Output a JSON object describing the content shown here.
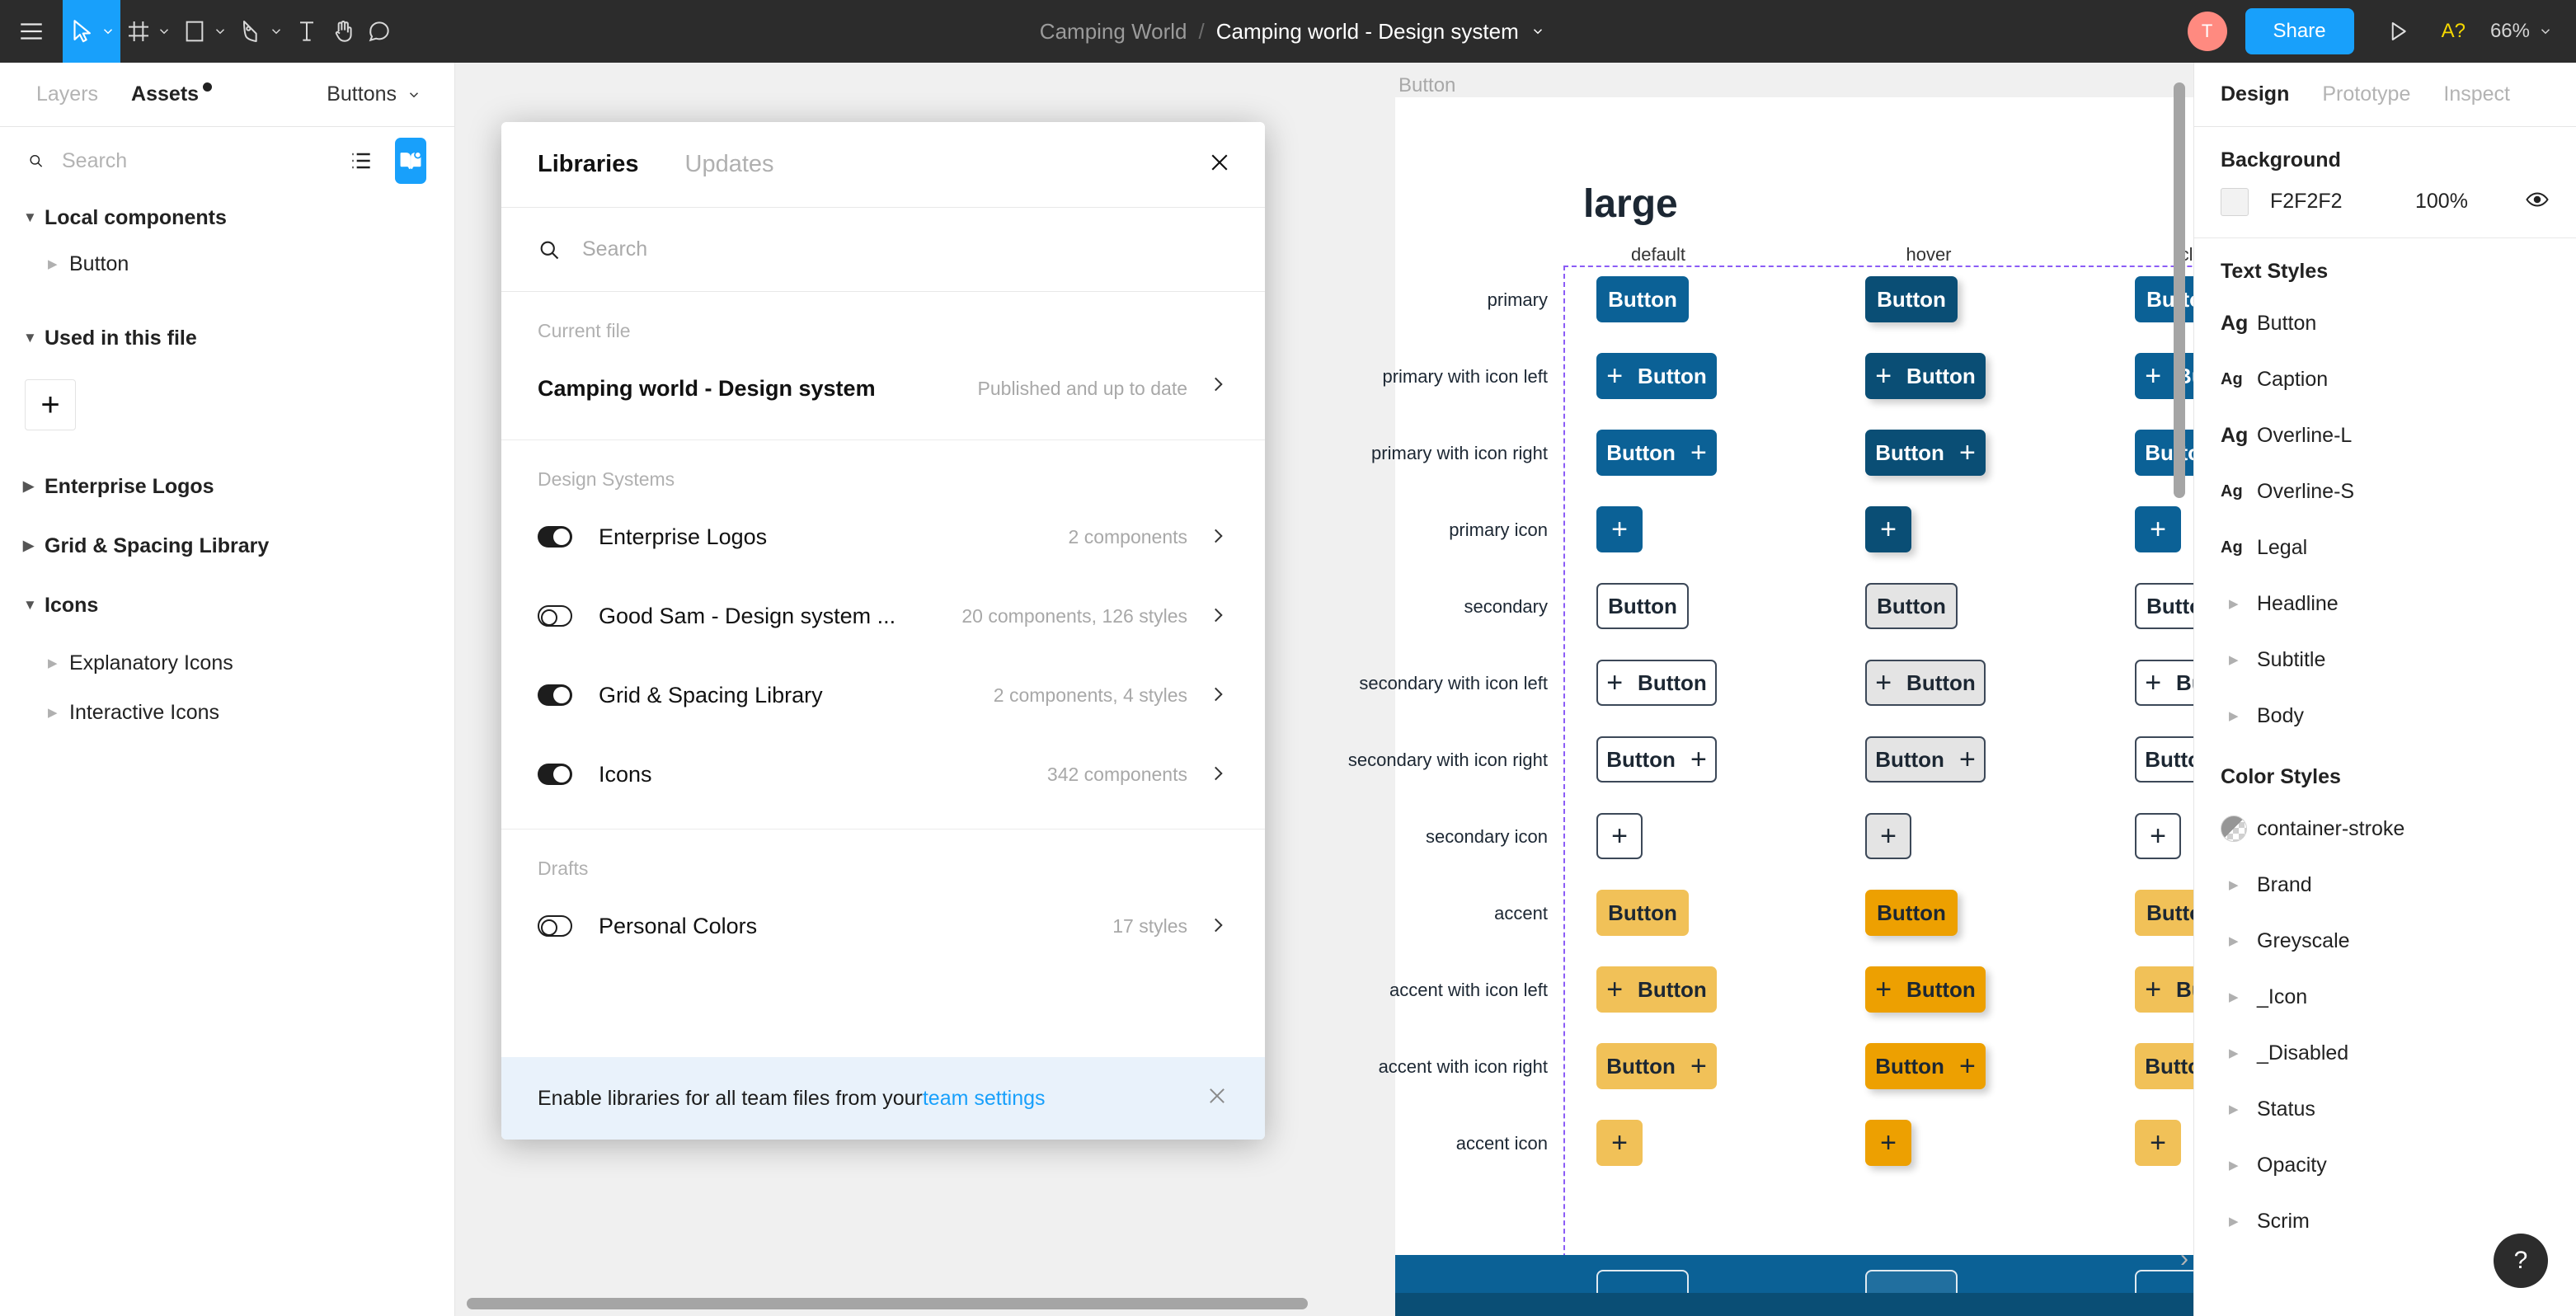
{
  "toolbar": {
    "menu_icon": "hamburger-menu-icon",
    "tools": [
      {
        "name": "move-tool",
        "icon": "cursor-arrow-icon",
        "has_chevron": true,
        "active": true
      },
      {
        "name": "frame-tool",
        "icon": "frame-grid-icon",
        "has_chevron": true,
        "active": false
      },
      {
        "name": "shape-tool",
        "icon": "rectangle-icon",
        "has_chevron": true,
        "active": false
      },
      {
        "name": "pen-tool",
        "icon": "pen-nib-icon",
        "has_chevron": true,
        "active": false
      },
      {
        "name": "text-tool",
        "icon": "text-T-icon",
        "has_chevron": false,
        "active": false
      },
      {
        "name": "hand-tool",
        "icon": "hand-icon",
        "has_chevron": false,
        "active": false
      },
      {
        "name": "comment-tool",
        "icon": "comment-bubble-icon",
        "has_chevron": false,
        "active": false
      }
    ],
    "team_name": "Camping World",
    "separator": "/",
    "file_name": "Camping world - Design system",
    "avatar_initial": "T",
    "share_label": "Share",
    "present_icon": "play-triangle-icon",
    "accessibility_label": "A?",
    "zoom_level": "66%"
  },
  "left_panel": {
    "tabs": [
      {
        "label": "Layers",
        "active": false
      },
      {
        "label": "Assets",
        "active": true,
        "has_dot": true
      }
    ],
    "page_selector": "Buttons",
    "search_placeholder": "Search",
    "search_value": "",
    "view_list_icon": "list-view-icon",
    "view_library_icon": "library-book-icon",
    "sections": [
      {
        "label": "Local components",
        "expanded": true,
        "type": "section"
      },
      {
        "label": "Button",
        "expanded": false,
        "type": "item"
      },
      {
        "label": "Used in this file",
        "expanded": true,
        "type": "section"
      },
      {
        "label": "+",
        "type": "plus"
      },
      {
        "label": "Enterprise Logos",
        "expanded": false,
        "type": "section"
      },
      {
        "label": "Grid & Spacing Library",
        "expanded": false,
        "type": "section"
      },
      {
        "label": "Icons",
        "expanded": true,
        "type": "section"
      },
      {
        "label": "Explanatory Icons",
        "expanded": false,
        "type": "item"
      },
      {
        "label": "Interactive Icons",
        "expanded": false,
        "type": "item"
      }
    ]
  },
  "modal": {
    "tabs": [
      {
        "label": "Libraries",
        "active": true
      },
      {
        "label": "Updates",
        "active": false
      }
    ],
    "close_icon": "close-x-icon",
    "search_placeholder": "Search",
    "search_value": "",
    "groups": [
      {
        "title": "Current file",
        "rows": [
          {
            "name": "Camping world - Design system",
            "meta": "Published and up to date",
            "has_toggle": false,
            "bold": true
          }
        ]
      },
      {
        "title": "Design Systems",
        "rows": [
          {
            "name": "Enterprise Logos",
            "meta": "2 components",
            "has_toggle": true,
            "toggle_on": true
          },
          {
            "name": "Good Sam - Design system ...",
            "meta": "20 components, 126 styles",
            "has_toggle": true,
            "toggle_on": false
          },
          {
            "name": "Grid & Spacing Library",
            "meta": "2 components, 4 styles",
            "has_toggle": true,
            "toggle_on": true
          },
          {
            "name": "Icons",
            "meta": "342 components",
            "has_toggle": true,
            "toggle_on": true
          }
        ]
      },
      {
        "title": "Drafts",
        "rows": [
          {
            "name": "Personal Colors",
            "meta": "17 styles",
            "has_toggle": true,
            "toggle_on": false
          }
        ]
      }
    ],
    "footer_text_before": "Enable libraries for all team files from your ",
    "footer_link": "team settings",
    "footer_close_icon": "close-x-icon"
  },
  "right_panel": {
    "tabs": [
      {
        "label": "Design",
        "active": true
      },
      {
        "label": "Prototype",
        "active": false
      },
      {
        "label": "Inspect",
        "active": false
      }
    ],
    "background": {
      "title": "Background",
      "hex": "F2F2F2",
      "opacity": "100%",
      "visibility_icon": "eye-icon"
    },
    "text_styles": {
      "title": "Text Styles",
      "items": [
        {
          "label": "Button",
          "glyph": "Ag",
          "size": "big",
          "type": "style"
        },
        {
          "label": "Caption",
          "glyph": "Ag",
          "size": "small",
          "type": "style"
        },
        {
          "label": "Overline-L",
          "glyph": "Ag",
          "size": "big",
          "type": "style"
        },
        {
          "label": "Overline-S",
          "glyph": "Ag",
          "size": "small",
          "type": "style"
        },
        {
          "label": "Legal",
          "glyph": "Ag",
          "size": "small",
          "type": "style"
        },
        {
          "label": "Headline",
          "type": "folder"
        },
        {
          "label": "Subtitle",
          "type": "folder"
        },
        {
          "label": "Body",
          "type": "folder"
        }
      ]
    },
    "color_styles": {
      "title": "Color Styles",
      "items": [
        {
          "label": "container-stroke",
          "type": "color"
        },
        {
          "label": "Brand",
          "type": "folder"
        },
        {
          "label": "Greyscale",
          "type": "folder"
        },
        {
          "label": "_Icon",
          "type": "folder"
        },
        {
          "label": "_Disabled",
          "type": "folder"
        },
        {
          "label": "Status",
          "type": "folder"
        },
        {
          "label": "Opacity",
          "type": "folder"
        },
        {
          "label": "Scrim",
          "type": "folder"
        }
      ]
    },
    "help_label": "?"
  },
  "canvas": {
    "frame_label": "Button",
    "frame_title": "large",
    "columns": [
      "default",
      "hover",
      "click"
    ],
    "rows": [
      {
        "label": "primary",
        "variant": "primary",
        "shape": "text"
      },
      {
        "label": "primary with icon left",
        "variant": "primary",
        "shape": "icon-left"
      },
      {
        "label": "primary with icon right",
        "variant": "primary",
        "shape": "icon-right"
      },
      {
        "label": "primary icon",
        "variant": "primary",
        "shape": "icon-only"
      },
      {
        "label": "secondary",
        "variant": "secondary",
        "shape": "text"
      },
      {
        "label": "secondary with icon left",
        "variant": "secondary",
        "shape": "icon-left"
      },
      {
        "label": "secondary with icon right",
        "variant": "secondary",
        "shape": "icon-right"
      },
      {
        "label": "secondary icon",
        "variant": "secondary",
        "shape": "icon-only"
      },
      {
        "label": "accent",
        "variant": "accent",
        "shape": "text"
      },
      {
        "label": "accent with icon left",
        "variant": "accent",
        "shape": "icon-left"
      },
      {
        "label": "accent with icon right",
        "variant": "accent",
        "shape": "icon-right"
      },
      {
        "label": "accent icon",
        "variant": "accent",
        "shape": "icon-only"
      }
    ],
    "button_label": "Button",
    "icon_glyph": "+",
    "colors": {
      "primary": "#0B6196",
      "primary_hover": "#0A4E75",
      "secondary_bg": "#FFFFFF",
      "secondary_hover_bg": "#E4E4E4",
      "secondary_border": "#3C4858",
      "accent": "#F1C158",
      "accent_hover": "#EDA001",
      "frame_bg": "#FFFFFF",
      "canvas_bg": "#F0F0F0",
      "selection_dash": "#8B5CF6"
    }
  }
}
